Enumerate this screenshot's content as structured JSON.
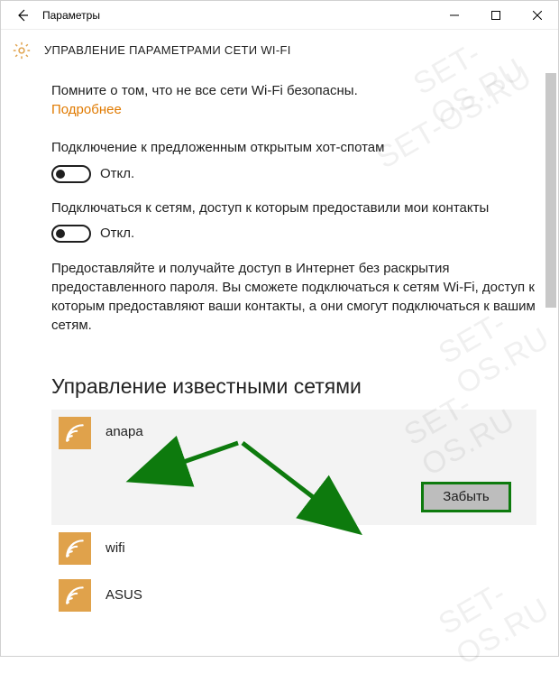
{
  "titlebar": {
    "title": "Параметры"
  },
  "header": {
    "title": "УПРАВЛЕНИЕ ПАРАМЕТРАМИ СЕТИ WI-FI"
  },
  "body": {
    "safety_note": "Помните о том, что не все сети Wi-Fi безопасны.",
    "learn_more": "Подробнее",
    "toggle1": {
      "label": "Подключение к предложенным открытым хот-спотам",
      "state": "Откл."
    },
    "toggle2": {
      "label": "Подключаться к сетям, доступ к которым предоставили мои контакты",
      "state": "Откл."
    },
    "sharing_text": "Предоставляйте и получайте доступ в Интернет без раскрытия предоставленного пароля. Вы сможете подключаться к сетям Wi-Fi, доступ к которым предоставляют ваши контакты, а они смогут подключаться к вашим сетям."
  },
  "networks": {
    "section_title": "Управление известными сетями",
    "items": [
      {
        "name": "anapa",
        "selected": true
      },
      {
        "name": "wifi",
        "selected": false
      },
      {
        "name": "ASUS",
        "selected": false
      }
    ],
    "forget_label": "Забыть"
  },
  "watermark": "SET-OS.RU",
  "colors": {
    "accent_orange": "#e07a00",
    "wifi_tile": "#e0a24b",
    "annotation_green": "#0d7a0d"
  }
}
